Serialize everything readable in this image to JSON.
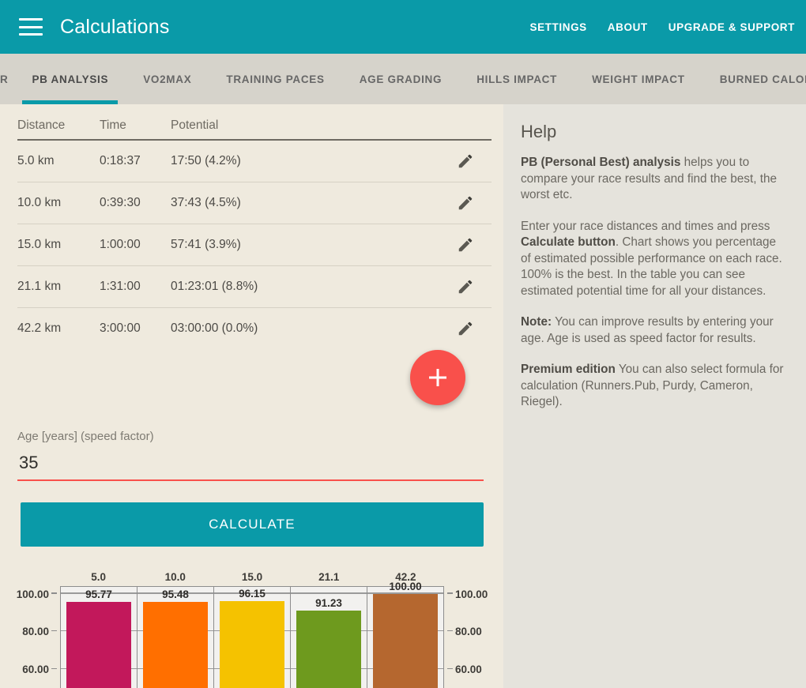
{
  "appbar": {
    "menu_icon": "hamburger-menu-icon",
    "title": "Calculations",
    "actions": [
      {
        "label": "SETTINGS"
      },
      {
        "label": "ABOUT"
      },
      {
        "label": "UPGRADE & SUPPORT"
      }
    ]
  },
  "tabs": [
    {
      "label": "R",
      "active": false,
      "partial": true
    },
    {
      "label": "PB ANALYSIS",
      "active": true
    },
    {
      "label": "VO2MAX",
      "active": false
    },
    {
      "label": "TRAINING PACES",
      "active": false
    },
    {
      "label": "AGE GRADING",
      "active": false
    },
    {
      "label": "HILLS IMPACT",
      "active": false
    },
    {
      "label": "WEIGHT IMPACT",
      "active": false
    },
    {
      "label": "BURNED CALORIES",
      "active": false
    }
  ],
  "table": {
    "headers": [
      "Distance",
      "Time",
      "Potential"
    ],
    "edit_icon": "pencil-icon",
    "rows": [
      {
        "distance": "5.0 km",
        "time": "0:18:37",
        "potential": "17:50 (4.2%)"
      },
      {
        "distance": "10.0 km",
        "time": "0:39:30",
        "potential": "37:43 (4.5%)"
      },
      {
        "distance": "15.0 km",
        "time": "1:00:00",
        "potential": "57:41 (3.9%)"
      },
      {
        "distance": "21.1 km",
        "time": "1:31:00",
        "potential": "01:23:01 (8.8%)"
      },
      {
        "distance": "42.2 km",
        "time": "3:00:00",
        "potential": "03:00:00 (0.0%)"
      }
    ]
  },
  "fab": {
    "icon": "plus-icon",
    "color": "#f9504b"
  },
  "age_field": {
    "label": "Age [years] (speed factor)",
    "value": "35",
    "placeholder": "",
    "underline_color": "#f9504b"
  },
  "calculate_button": {
    "label": "CALCULATE",
    "color": "#0a9aa8"
  },
  "help": {
    "title": "Help",
    "paragraphs": [
      {
        "bold": "PB (Personal Best) analysis",
        "rest": " helps you to compare your race results and find the best, the worst etc."
      },
      {
        "bold": "",
        "rest": "Enter your race distances and times and press ",
        "bold2": "Calculate button",
        "rest2": ". Chart shows you percentage of estimated possible performance on each race. 100% is the best. In the table you can see estimated potential time for all your distances."
      },
      {
        "bold": "Note:",
        "rest": " You can improve results by entering your age. Age is used as speed factor for results."
      },
      {
        "bold": "Premium edition",
        "rest": " You can also select formula for calculation (Runners.Pub, Purdy, Cameron, Riegel)."
      }
    ]
  },
  "theme": {
    "accent_teal": "#0a9aa8",
    "accent_red": "#f9504b",
    "content_bg": "#efeade",
    "help_bg": "#e5e3dc",
    "tabbar_bg": "#d6d3cb"
  },
  "chart_data": {
    "type": "bar",
    "title": "",
    "xlabel": "",
    "ylabel": "",
    "categories": [
      "5.0",
      "10.0",
      "15.0",
      "21.1",
      "42.2"
    ],
    "values": [
      95.77,
      95.48,
      96.15,
      91.23,
      100.0
    ],
    "value_labels": [
      "95.77",
      "95.48",
      "96.15",
      "91.23",
      "100.00"
    ],
    "colors": [
      "#c2185b",
      "#ff6f00",
      "#f5c200",
      "#6e9a1e",
      "#b5672f"
    ],
    "ylim": [
      50,
      104
    ],
    "yticks": [
      100.0,
      80.0,
      60.0
    ],
    "ytick_labels": [
      "100.00",
      "80.00",
      "60.00"
    ],
    "ytick_labels_right": [
      "100.00",
      "80.00",
      "60.00"
    ],
    "grid": true,
    "legend": "none",
    "note": "chart is clipped by the bottom edge of the viewport below the 60.00 gridline"
  }
}
